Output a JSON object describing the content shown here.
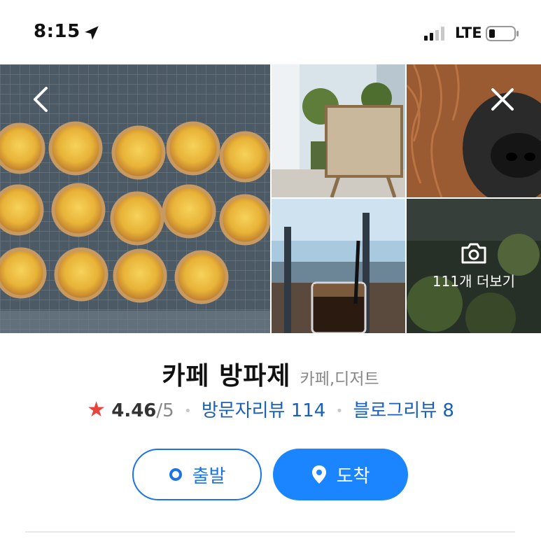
{
  "status_bar": {
    "time": "8:15",
    "carrier": "LTE",
    "location_icon": "location-arrow-icon",
    "signal_icon": "cell-signal-icon",
    "battery_icon": "battery-low-icon"
  },
  "gallery": {
    "photos": [
      {
        "name": "egg-tarts-on-rack"
      },
      {
        "name": "entrance-sign"
      },
      {
        "name": "dog-closeup"
      },
      {
        "name": "drink-by-window"
      },
      {
        "name": "plants-interior"
      }
    ],
    "more_label": "111개 더보기",
    "back_icon": "chevron-left-icon",
    "close_icon": "close-icon",
    "camera_icon": "camera-icon"
  },
  "place": {
    "name": "카페 방파제",
    "category": "카페,디저트",
    "rating": "4.46",
    "rating_max": "/5",
    "visitor_reviews": "방문자리뷰 114",
    "blog_reviews": "블로그리뷰 8"
  },
  "actions": {
    "depart_label": "출발",
    "arrive_label": "도착"
  },
  "colors": {
    "accent": "#1a85ff",
    "link": "#1a5fba",
    "star": "#e9433c"
  }
}
